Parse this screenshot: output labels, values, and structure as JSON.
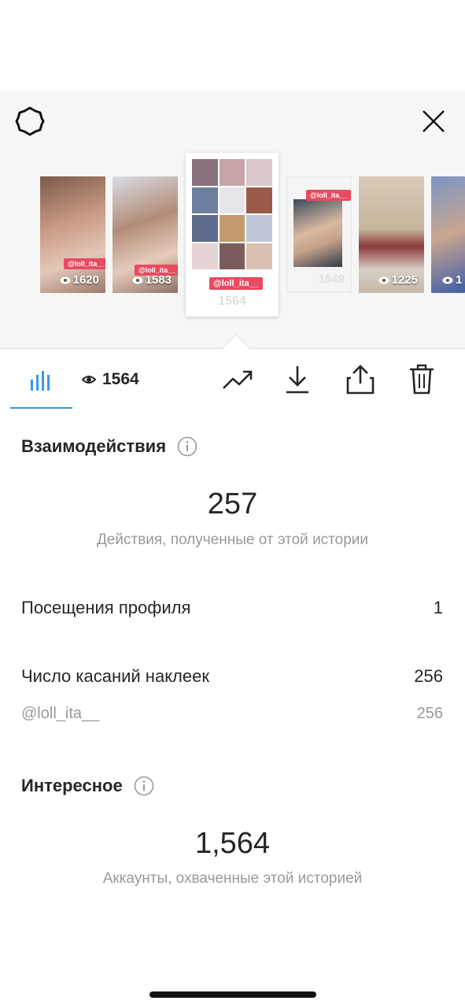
{
  "stories": [
    {
      "count": "1620",
      "sticker": "@loll_ita__"
    },
    {
      "count": "1583",
      "sticker": "@loll_ita__"
    },
    {
      "count": "1564",
      "sticker": "@loll_ita__"
    },
    {
      "count": "1549",
      "sticker": "@loll_ita__"
    },
    {
      "count": "1225"
    },
    {
      "count": "1"
    }
  ],
  "tabs": {
    "views_count": "1564"
  },
  "interactions": {
    "title": "Взаимодействия",
    "total": "257",
    "caption": "Действия, полученные от этой истории",
    "rows": [
      {
        "label": "Посещения профиля",
        "value": "1"
      },
      {
        "label": "Число касаний наклеек",
        "value": "256"
      }
    ],
    "sub_rows": [
      {
        "label": "@loll_ita__",
        "value": "256"
      }
    ]
  },
  "discovery": {
    "title": "Интересное",
    "total": "1,564",
    "caption": "Аккаунты, охваченные этой историей"
  },
  "icons": {
    "settings": "gear-icon",
    "close": "close-icon",
    "insights": "bar-chart-icon",
    "views": "eye-icon",
    "promote": "trending-up-icon",
    "download": "download-icon",
    "share": "share-icon",
    "delete": "trash-icon",
    "info": "info-icon"
  },
  "colors": {
    "accent": "#3897f0",
    "sticker": "#e84a5f",
    "text": "#262626",
    "secondary_text": "#999999"
  }
}
